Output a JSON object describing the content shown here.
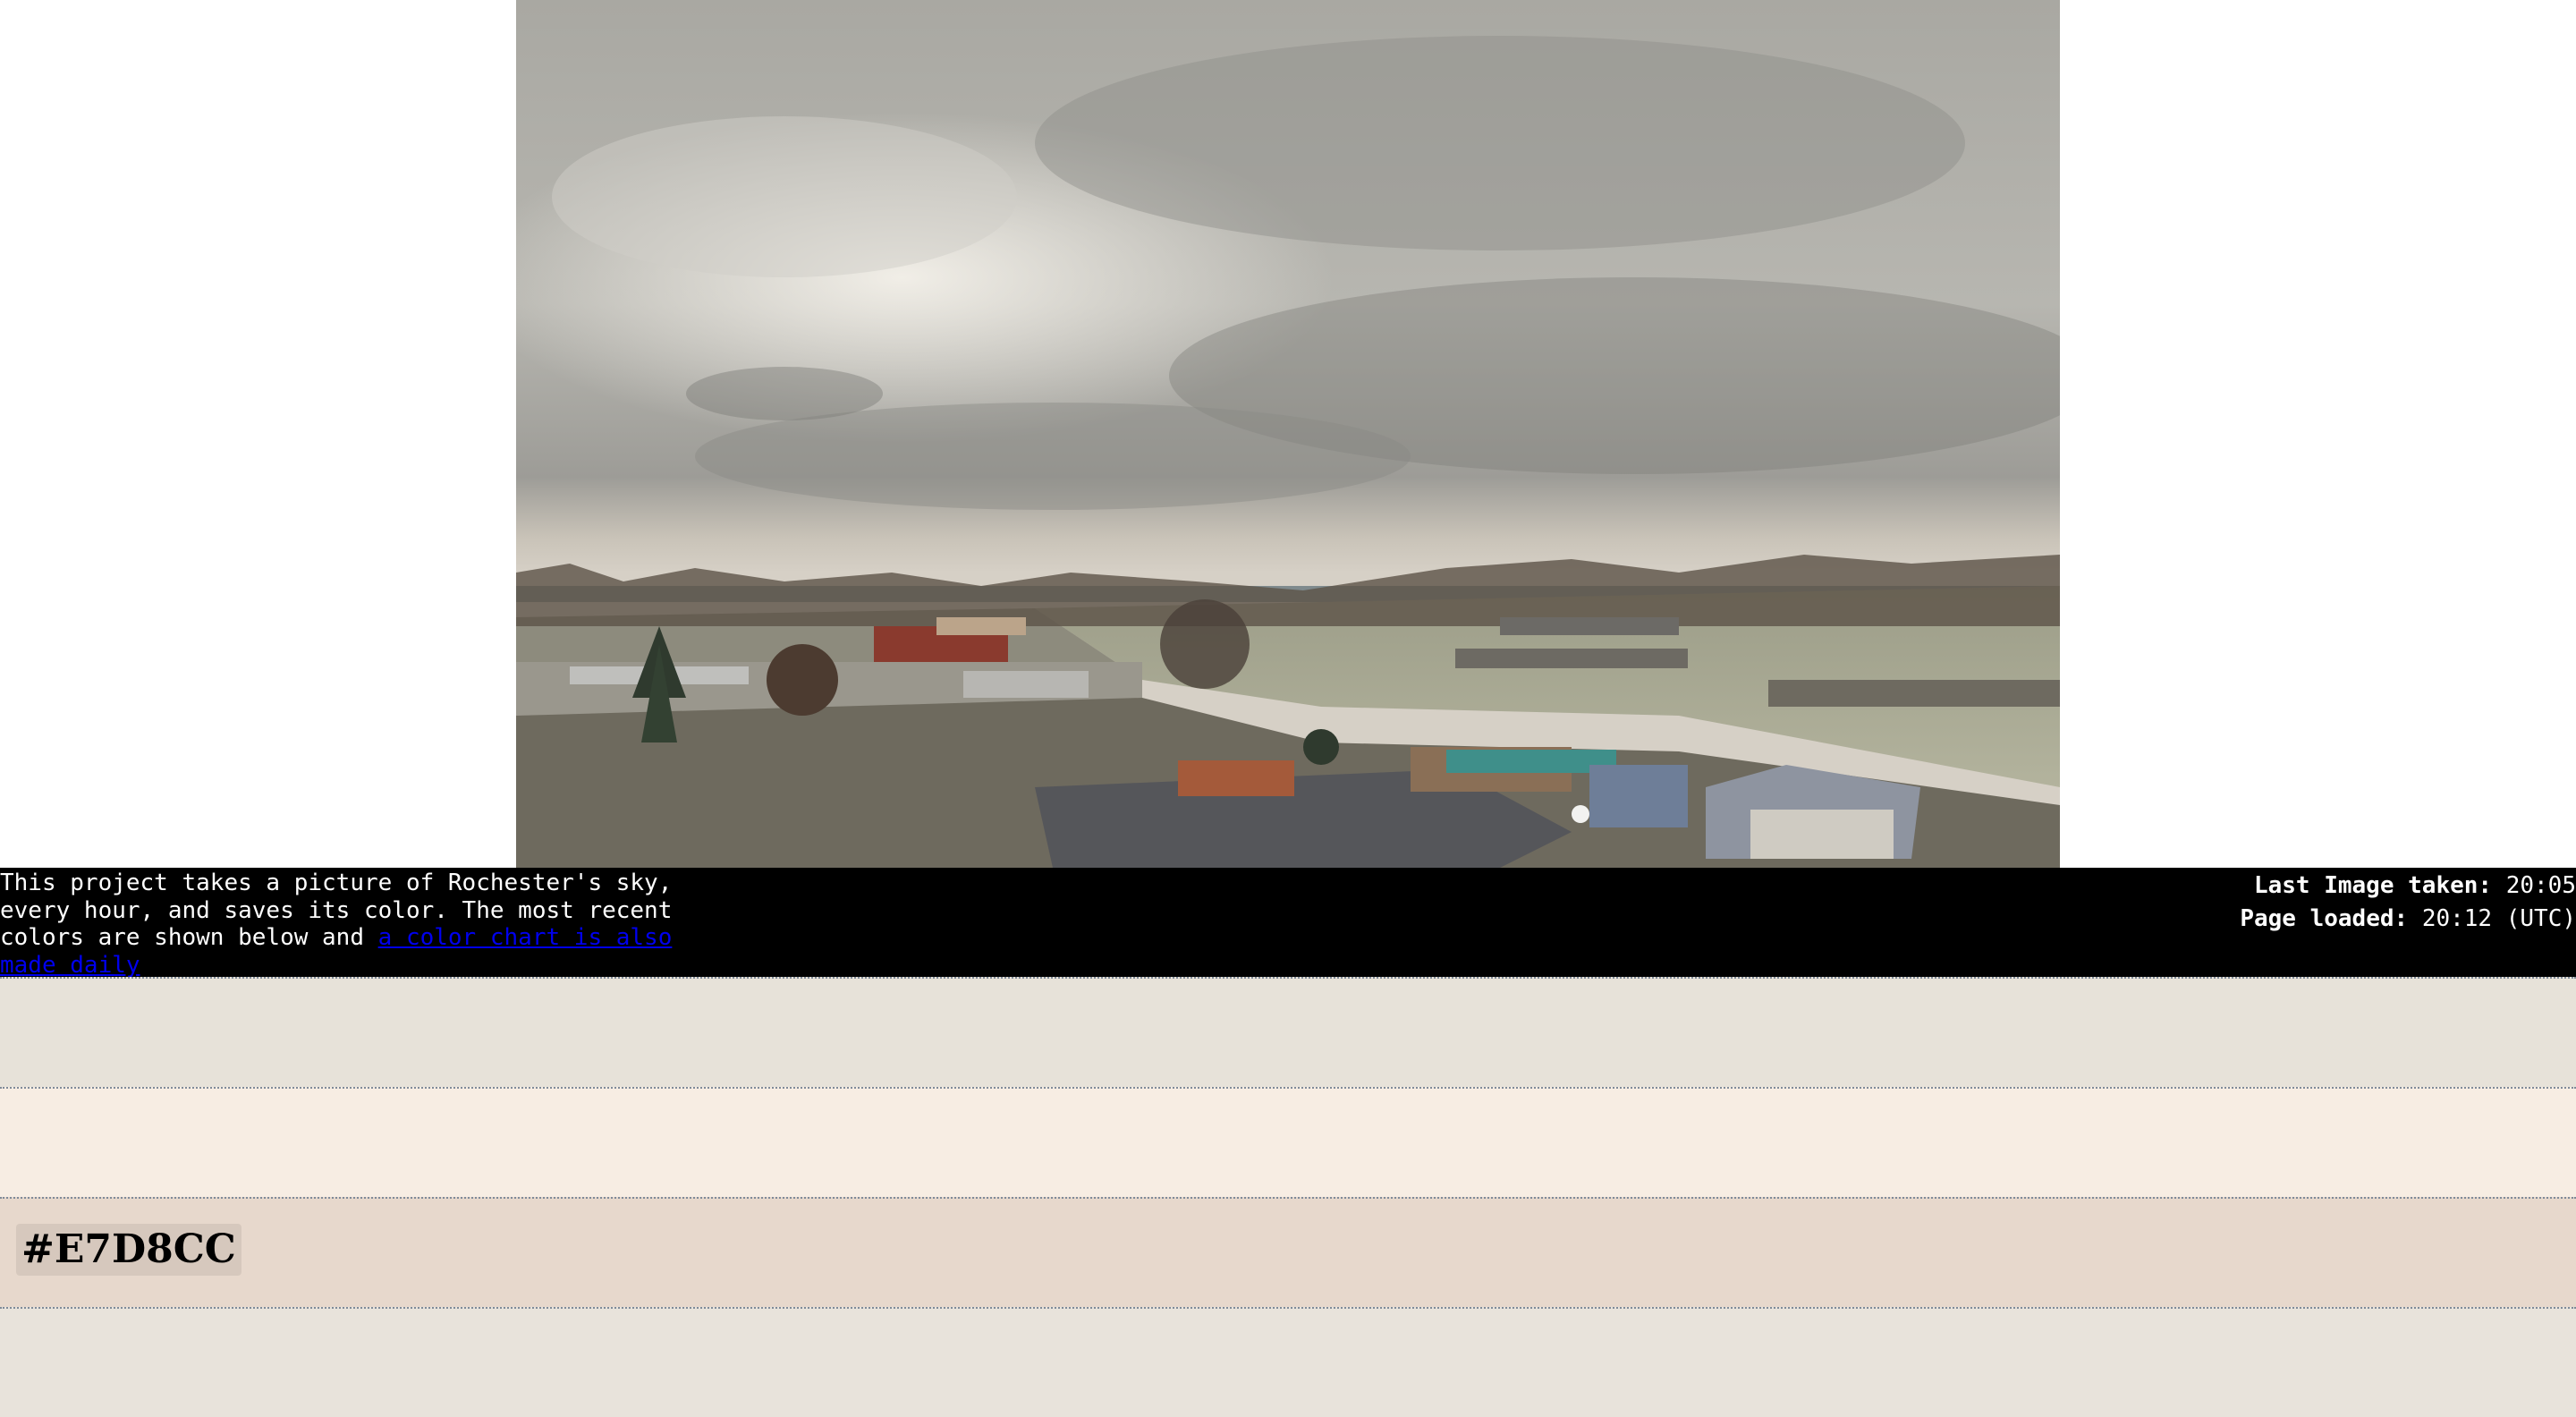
{
  "description": {
    "text": "This project takes a picture of Rochester's sky, every hour, and saves its color. The most recent colors are shown below and ",
    "link_text": "a color chart is also made daily"
  },
  "status": {
    "last_image_label": "Last Image taken:",
    "last_image_time": "20:05",
    "page_loaded_label": "Page loaded:",
    "page_loaded_time": "20:12 (UTC)"
  },
  "swatches": [
    {
      "color": "#E7E2D9",
      "label": ""
    },
    {
      "color": "#F7EDE3",
      "label": ""
    },
    {
      "color": "#E7D8CC",
      "label": "#E7D8CC"
    },
    {
      "color": "#E8E3DB",
      "label": ""
    }
  ],
  "colors": {
    "info_bar_bg": "#000000",
    "link": "#0000EE",
    "swatch_divider": "#7F8A99"
  }
}
